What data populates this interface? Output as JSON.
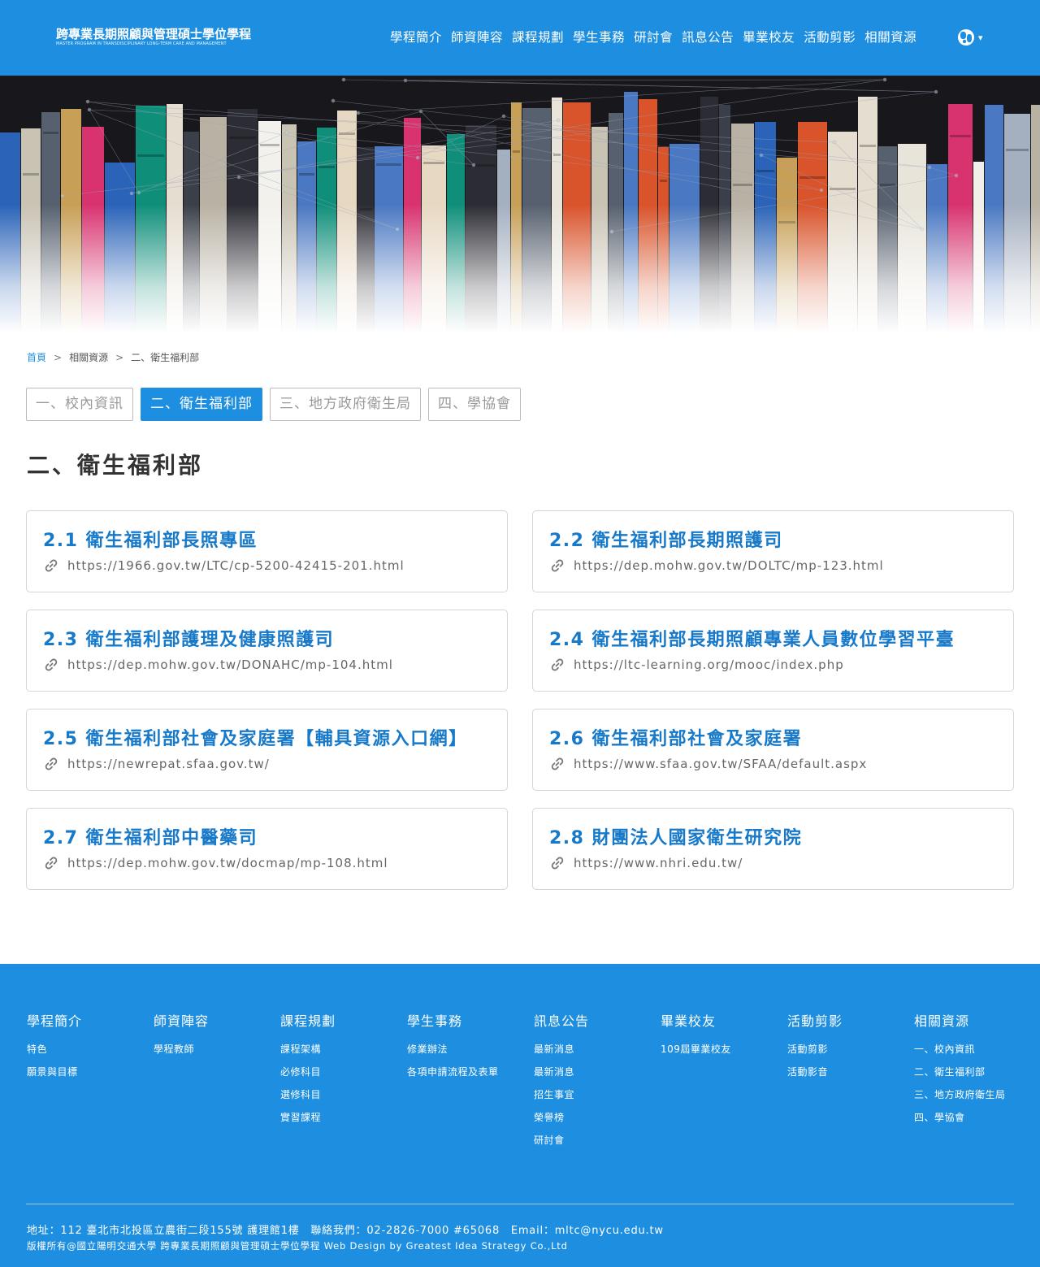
{
  "header": {
    "logo_title": "跨專業長期照顧與管理碩士學位學程",
    "logo_subtitle": "MASTER PROGRAM IN TRANSDISCIPLINARY LONG-TERM CARE AND MANAGEMENT",
    "nav": [
      "學程簡介",
      "師資陣容",
      "課程規劃",
      "學生事務",
      "研討會",
      "訊息公告",
      "畢業校友",
      "活動剪影",
      "相關資源"
    ],
    "language_caret": "▾"
  },
  "breadcrumb": {
    "home": "首頁",
    "sep": ">",
    "level1": "相關資源",
    "current": "二、衛生福利部"
  },
  "tabs": [
    {
      "label": "一、校內資訊",
      "active": false
    },
    {
      "label": "二、衛生福利部",
      "active": true
    },
    {
      "label": "三、地方政府衛生局",
      "active": false
    },
    {
      "label": "四、學協會",
      "active": false
    }
  ],
  "page_title": "二、衛生福利部",
  "cards": [
    {
      "title": "2.1 衛生福利部長照專區",
      "url": "https://1966.gov.tw/LTC/cp-5200-42415-201.html"
    },
    {
      "title": "2.2 衛生福利部長期照護司",
      "url": "https://dep.mohw.gov.tw/DOLTC/mp-123.html"
    },
    {
      "title": "2.3 衛生福利部護理及健康照護司",
      "url": "https://dep.mohw.gov.tw/DONAHC/mp-104.html"
    },
    {
      "title": "2.4 衛生福利部長期照顧專業人員數位學習平臺",
      "url": "https://ltc-learning.org/mooc/index.php"
    },
    {
      "title": "2.5 衛生福利部社會及家庭署【輔具資源入口網】",
      "url": "https://newrepat.sfaa.gov.tw/"
    },
    {
      "title": "2.6 衛生福利部社會及家庭署",
      "url": "https://www.sfaa.gov.tw/SFAA/default.aspx"
    },
    {
      "title": "2.7 衛生福利部中醫藥司",
      "url": "https://dep.mohw.gov.tw/docmap/mp-108.html"
    },
    {
      "title": "2.8 財團法人國家衛生研究院",
      "url": "https://www.nhri.edu.tw/"
    }
  ],
  "footer": {
    "columns": [
      {
        "heading": "學程簡介",
        "links": [
          "特色",
          "願景與目標"
        ]
      },
      {
        "heading": "師資陣容",
        "links": [
          "學程教師"
        ]
      },
      {
        "heading": "課程規劃",
        "links": [
          "課程架構",
          "必修科目",
          "選修科目",
          "實習課程"
        ]
      },
      {
        "heading": "學生事務",
        "links": [
          "修業辦法",
          "各項申請流程及表單"
        ]
      },
      {
        "heading": "訊息公告",
        "links": [
          "最新消息",
          "最新消息",
          "招生事宜",
          "榮譽榜",
          "研討會"
        ]
      },
      {
        "heading": "畢業校友",
        "links": [
          "109屆畢業校友"
        ]
      },
      {
        "heading": "活動剪影",
        "links": [
          "活動剪影",
          "活動影音"
        ]
      },
      {
        "heading": "相關資源",
        "links": [
          "一、校內資訊",
          "二、衛生福利部",
          "三、地方政府衛生局",
          "四、學協會"
        ]
      }
    ],
    "address": "地址：112 臺北市北投區立農街二段155號 護理館1樓　聯絡我們：02-2826-7000 #65068　Email：mltc@nycu.edu.tw",
    "copyright": "版權所有@國立陽明交通大學 跨專業長期照顧與管理碩士學位學程 Web Design by Greatest Idea Strategy Co.,Ltd"
  },
  "colors": {
    "primary": "#1e8fe0",
    "card_title": "#1779c9",
    "hero_background": "#1b1b1f"
  },
  "icons": {
    "language": "globe-icon",
    "card_link": "link-icon"
  }
}
